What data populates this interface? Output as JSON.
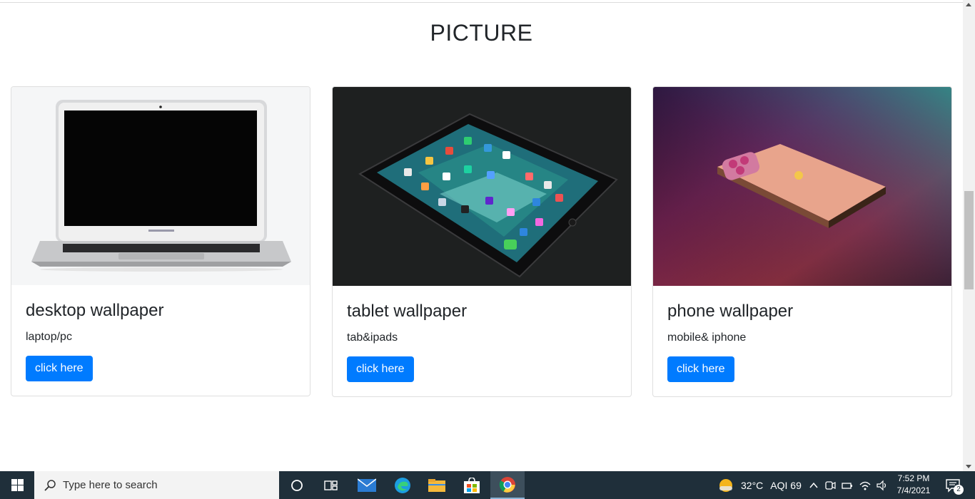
{
  "page": {
    "heading": "PICTURE",
    "cards": [
      {
        "title": "desktop wallpaper",
        "text": "laptop/pc",
        "button": "click here",
        "image": "laptop-photo"
      },
      {
        "title": "tablet wallpaper",
        "text": "tab&ipads",
        "button": "click here",
        "image": "tablet-photo"
      },
      {
        "title": "phone wallpaper",
        "text": "mobile& iphone",
        "button": "click here",
        "image": "phone-photo"
      }
    ],
    "accent_color": "#007bff"
  },
  "taskbar": {
    "search_placeholder": "Type here to search",
    "weather": "32°C",
    "aqi": "AQI 69",
    "time": "7:52 PM",
    "date": "7/4/2021",
    "notification_count": "2",
    "pinned": [
      "cortana-icon",
      "task-view-icon",
      "mail-icon",
      "edge-icon",
      "file-explorer-icon",
      "store-icon",
      "chrome-icon"
    ]
  }
}
